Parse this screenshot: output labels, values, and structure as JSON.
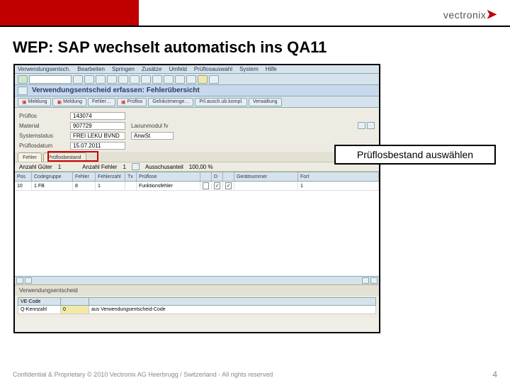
{
  "brand": {
    "name": "vectronix"
  },
  "slide": {
    "title": "WEP: SAP wechselt automatisch ins QA11",
    "callout": "Prüflosbestand auswählen",
    "footer": "Confidential & Proprietary © 2010 Vectronix AG Heerbrugg / Switzerland - All rights reserved",
    "page": "4"
  },
  "sap": {
    "menubar": [
      "Verwendungsentsch.",
      "Bearbeiten",
      "Springen",
      "Zusätze",
      "Umfeld",
      "Prüflosauswahl",
      "System",
      "Hilfe"
    ],
    "titlebar": "Verwendungsentscheid erfassen: Fehlerübersicht",
    "toolbar2": [
      "Meldung",
      "Meldung",
      "Fehler",
      "Prüflos",
      "Gelnkctmenge",
      "Prl.ausch.ub.kompl.",
      "Verwaltung"
    ],
    "form": {
      "label_prueflos": "Prüflos",
      "prueflos": "143074",
      "label_material": "Material",
      "material": "907729",
      "material_text": "Laounmodul fv",
      "label_system": "Systemstatus",
      "system": "FREI LEKU BVND",
      "system_text": "AnwSt",
      "label_date": "Prüflosdatum",
      "date": "15.07.2011"
    },
    "tabs": [
      "Fehler",
      "Prüflosbestand"
    ],
    "summary": {
      "label_anzahl": "Anzahl Güter",
      "anzahl": "1",
      "label_fehler": "Anzahl Fehler",
      "fehler": "1",
      "label_anteil": "Ausschusanteil",
      "anteil": "100,00 %"
    },
    "grid": {
      "headers": [
        "Pos",
        "Codegruppe",
        "Fehler",
        "Fehlerzahl",
        "Tx",
        "Prüflose",
        "",
        "D",
        "",
        "Gerätnummer",
        "Fort"
      ],
      "row": [
        "10",
        "1 FB",
        "8",
        "1",
        "",
        "Funktionsfehler",
        "",
        "✓",
        "✓",
        "",
        "1"
      ]
    },
    "footer": {
      "label": "Verwendungsentscheid",
      "headers": [
        "VE-Code",
        "",
        ""
      ],
      "vals": [
        "Q-Kennzahl",
        "0",
        "aus Verwendungsentscheid-Code"
      ]
    }
  }
}
